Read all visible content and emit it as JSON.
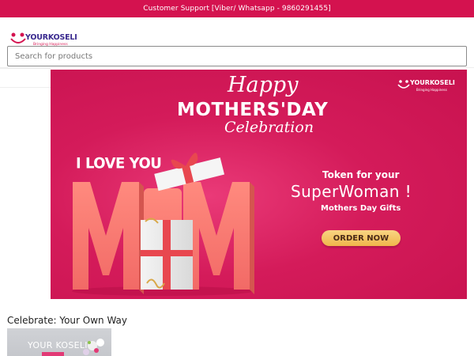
{
  "topbar": {
    "text": "Customer Support [Viber/ Whatsapp - 9860291455]"
  },
  "header": {
    "logo_text": "YOURKOSELI",
    "logo_tagline": "Bringing Happiness",
    "search_placeholder": "Search for products"
  },
  "banner": {
    "logo_text": "YOURKOSELI",
    "logo_tagline": "Bringing Happiness",
    "happy": "Happy",
    "mothers_day": "MOTHERS'DAY",
    "celebration": "Celebration",
    "i_love_you": "I LOVE YOU",
    "mom": "MOM",
    "token": "Token for your",
    "superwoman": "SuperWoman !",
    "gifts": "Mothers Day Gifts",
    "order_button": "ORDER NOW"
  },
  "section": {
    "heading": "Celebrate: Your Own Way",
    "thumb_label": "YOUR KOSELI"
  },
  "colors": {
    "brand_red": "#d4124f",
    "logo_purple": "#3a2a8f",
    "button_gold": "#f0b64b"
  }
}
